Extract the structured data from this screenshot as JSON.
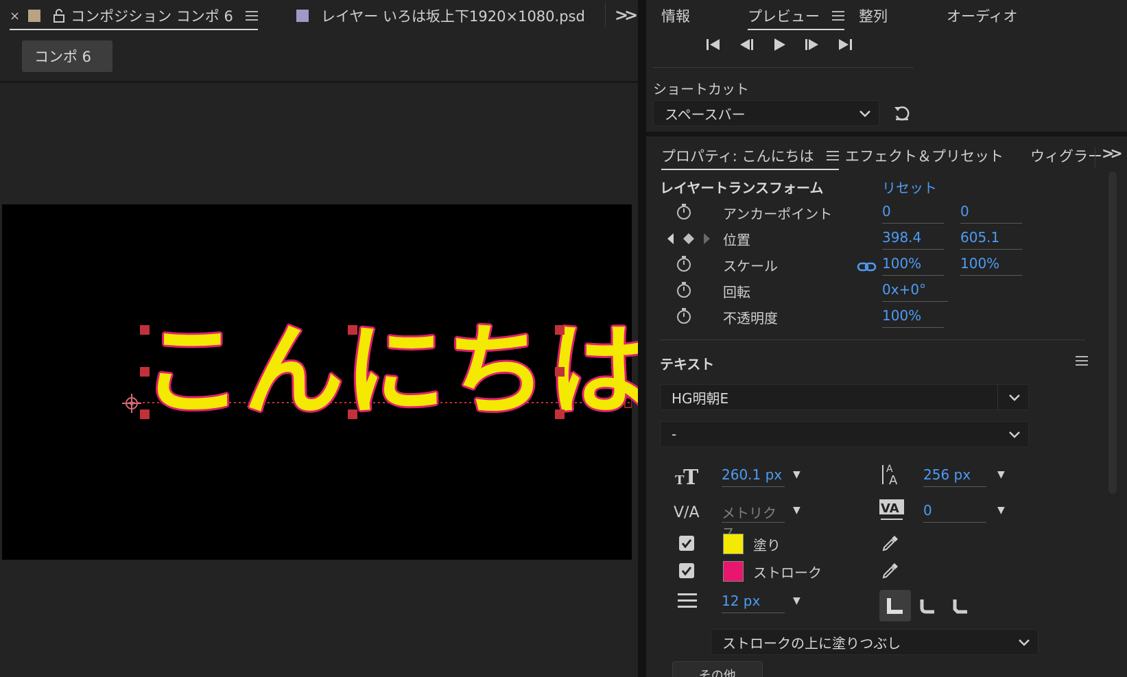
{
  "left_panel": {
    "tabs": [
      {
        "label": "コンポジション コンポ 6",
        "active": true
      },
      {
        "label": "レイヤー いろは坂上下1920×1080.psd",
        "active": false
      }
    ],
    "comp_chip": "コンポ 6",
    "canvas_text": "こんにちは"
  },
  "right_panel": {
    "top_tabs": [
      {
        "label": "情報"
      },
      {
        "label": "プレビュー",
        "active": true
      },
      {
        "label": "整列"
      },
      {
        "label": "オーディオ"
      }
    ],
    "shortcut": {
      "label": "ショートカット",
      "value": "スペースバー"
    },
    "prop_tabs": [
      {
        "label": "プロパティ: こんにちは",
        "active": true
      },
      {
        "label": "エフェクト＆プリセット"
      },
      {
        "label": "ウィグラー"
      }
    ],
    "transform": {
      "title": "レイヤートランスフォーム",
      "reset": "リセット",
      "rows": [
        {
          "label": "アンカーポイント",
          "v1": "0",
          "v2": "0"
        },
        {
          "label": "位置",
          "v1": "398.4",
          "v2": "605.1"
        },
        {
          "label": "スケール",
          "v1": "100%",
          "v2": "100%"
        },
        {
          "label": "回転",
          "v1": "0x+0°"
        },
        {
          "label": "不透明度",
          "v1": "100%"
        }
      ]
    },
    "text_section": {
      "title": "テキスト",
      "font_family": "HG明朝E",
      "font_style": "-",
      "font_size": "260.1 px",
      "leading": "256 px",
      "kerning": "メトリクス",
      "tracking": "0",
      "fill_label": "塗り",
      "stroke_label": "ストローク",
      "fill_color": "#f4e900",
      "stroke_color": "#e8166e",
      "stroke_width": "12 px",
      "stroke_order": "ストロークの上に塗りつぶし",
      "more": "… その他"
    }
  },
  "colors": {
    "accent_blue": "#4d9cf5",
    "handle_red": "#c2313a"
  }
}
